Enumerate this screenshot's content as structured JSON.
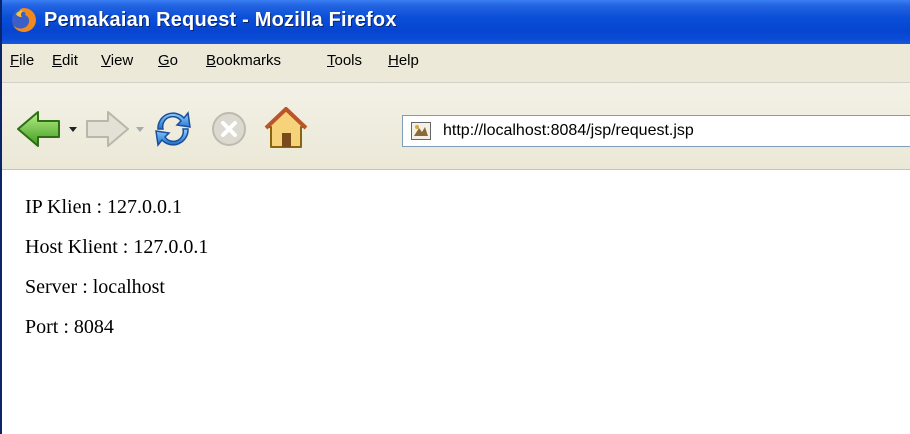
{
  "window": {
    "title": "Pemakaian Request - Mozilla Firefox"
  },
  "menu": {
    "items": [
      {
        "mnemonic": "F",
        "rest": "ile"
      },
      {
        "mnemonic": "E",
        "rest": "dit"
      },
      {
        "mnemonic": "V",
        "rest": "iew"
      },
      {
        "mnemonic": "G",
        "rest": "o"
      },
      {
        "mnemonic": "B",
        "rest": "ookmarks"
      },
      {
        "mnemonic": "T",
        "rest": "ools"
      },
      {
        "mnemonic": "H",
        "rest": "elp"
      }
    ]
  },
  "toolbar": {
    "icons": [
      "back-icon",
      "forward-icon",
      "reload-icon",
      "stop-icon",
      "home-icon",
      "page-icon"
    ],
    "url": "http://localhost:8084/jsp/request.jsp"
  },
  "content": {
    "lines": [
      "IP Klien : 127.0.0.1",
      "Host Klient : 127.0.0.1",
      "Server : localhost",
      "Port : 8084"
    ]
  },
  "colors": {
    "titlebar": "#0645d0",
    "chrome": "#ece9d8",
    "url_border": "#7f9db9"
  }
}
